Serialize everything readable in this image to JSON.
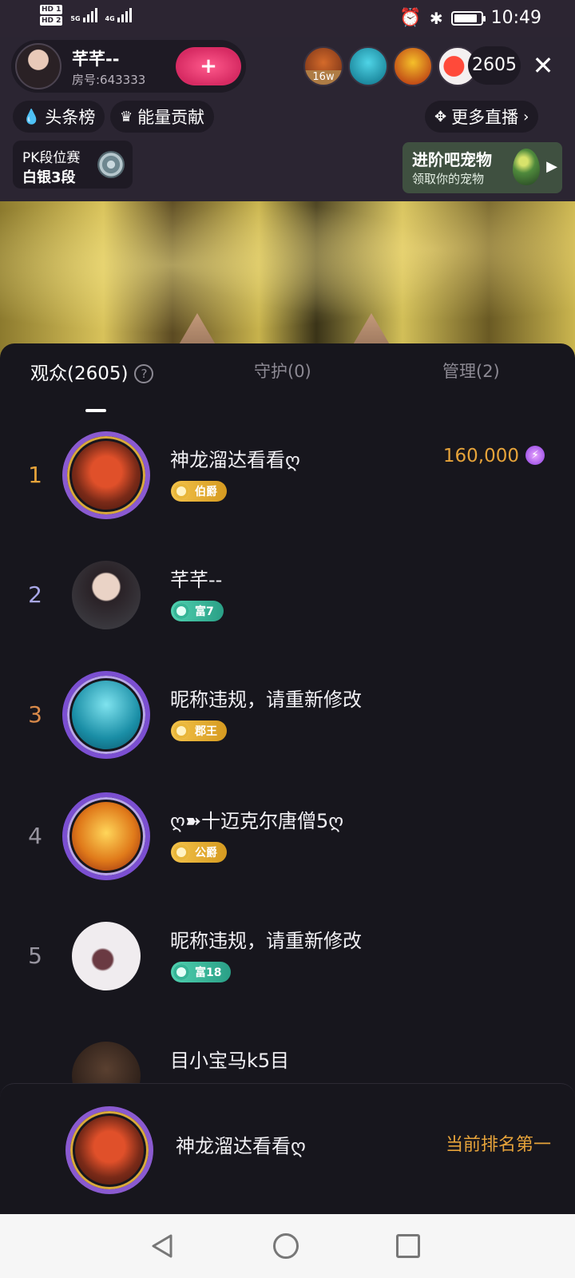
{
  "status_bar": {
    "hd1": "HD 1",
    "hd2": "HD 2",
    "net1": "5G",
    "net2": "4G",
    "time": "10:49"
  },
  "host": {
    "name": "芊芊--",
    "room": "房号:643333",
    "follow_label": "+"
  },
  "viewers_top": [
    {
      "badge": "16w"
    },
    {
      "badge": ""
    },
    {
      "badge": ""
    },
    {
      "badge": ""
    }
  ],
  "viewer_count": "2605",
  "close_label": "✕",
  "chips": {
    "headline_rank": "头条榜",
    "energy": "能量贡献",
    "more_live": "更多直播"
  },
  "pk": {
    "title": "PK段位赛",
    "rank": "白银3段"
  },
  "pet_banner": {
    "title": "进阶吧宠物",
    "subtitle": "领取你的宠物"
  },
  "tabs": [
    {
      "label": "观众(2605)"
    },
    {
      "label": "守护(0)"
    },
    {
      "label": "管理(2)"
    }
  ],
  "audience": [
    {
      "rank": "1",
      "name": "神龙溜达看看ღ",
      "badge": "伯爵",
      "score": "160,000"
    },
    {
      "rank": "2",
      "name": "芊芊--",
      "badge": "富7",
      "score": ""
    },
    {
      "rank": "3",
      "name": "昵称违规，请重新修改",
      "badge": "郡王",
      "score": ""
    },
    {
      "rank": "4",
      "name": "ღ➽十迈克尔唐僧5ღ",
      "badge": "公爵",
      "score": ""
    },
    {
      "rank": "5",
      "name": "昵称违规，请重新修改",
      "badge": "富18",
      "score": ""
    },
    {
      "rank": "",
      "name": "目小宝马k5目",
      "badge": "",
      "score": ""
    }
  ],
  "my_rank": {
    "name": "神龙溜达看看ღ",
    "status": "当前排名第一"
  },
  "colors": {
    "gold": "#e6a33a",
    "panel": "#17161d",
    "header": "#2b2532"
  }
}
